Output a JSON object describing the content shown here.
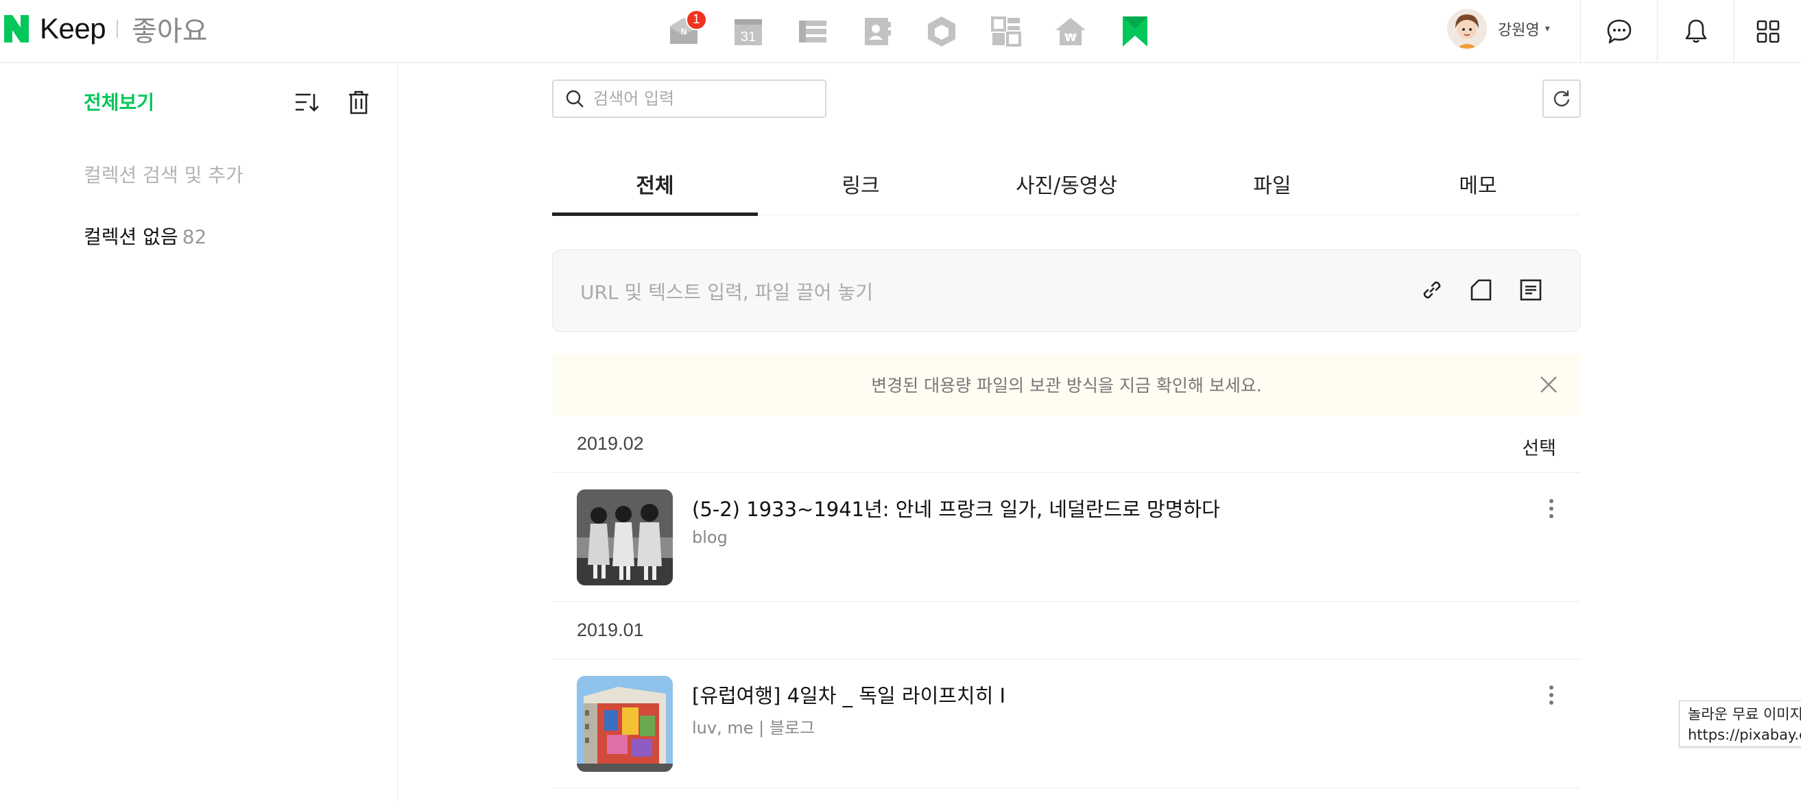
{
  "header": {
    "brand_name": "Keep",
    "section_title": "좋아요",
    "mail_badge": "1",
    "calendar_day": "31",
    "user_name": "강원영",
    "caret": "▾"
  },
  "colors": {
    "brand_green": "#03c75a",
    "badge_red": "#f0331f",
    "active_tab_underline": "#222222"
  },
  "icons": [
    "mail-icon",
    "calendar-icon",
    "list-icon",
    "contacts-icon",
    "cube-icon",
    "board-icon",
    "pay-icon",
    "bookmark-icon",
    "chat-icon",
    "bell-icon",
    "app-grid-icon",
    "sort-icon",
    "trash-icon",
    "search-icon",
    "refresh-icon",
    "link-icon",
    "file-icon",
    "memo-icon",
    "close-icon",
    "more-icon"
  ],
  "sidebar": {
    "title": "전체보기",
    "collection_search": "컬렉션 검색 및 추가",
    "no_collection_label": "컬렉션 없음",
    "no_collection_count": "82"
  },
  "main": {
    "search_placeholder": "검색어 입력",
    "tabs": [
      {
        "label": "전체",
        "active": true
      },
      {
        "label": "링크",
        "active": false
      },
      {
        "label": "사진/동영상",
        "active": false
      },
      {
        "label": "파일",
        "active": false
      },
      {
        "label": "메모",
        "active": false
      }
    ],
    "dropzone_placeholder": "URL 및 텍스트 입력, 파일 끌어 놓기",
    "notice": "변경된 대용량 파일의 보관 방식을 지금 확인해 보세요.",
    "select_label": "선택",
    "groups": [
      {
        "date": "2019.02",
        "items": [
          {
            "title": "(5-2) 1933~1941년: 안네 프랑크 일가, 네덜란드로 망명하다",
            "meta": "blog"
          }
        ]
      },
      {
        "date": "2019.01",
        "items": [
          {
            "title": "[유럽여행] 4일차 _ 독일 라이프치히 I",
            "meta": "luv, me | 블로그"
          }
        ]
      }
    ]
  },
  "tooltip": {
    "line1": "놀라운 무료 이미지",
    "line2": "https://pixabay.c"
  }
}
